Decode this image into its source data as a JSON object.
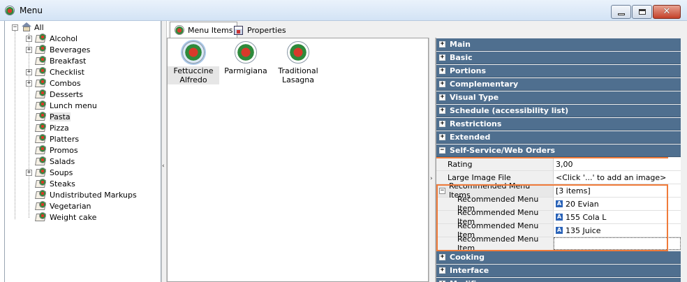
{
  "window": {
    "title": "Menu"
  },
  "tree": {
    "root": {
      "label": "All"
    },
    "items": [
      {
        "label": "Alcohol",
        "expandable": true
      },
      {
        "label": "Beverages",
        "expandable": true
      },
      {
        "label": "Breakfast",
        "expandable": false
      },
      {
        "label": "Checklist",
        "expandable": true
      },
      {
        "label": "Combos",
        "expandable": true
      },
      {
        "label": "Desserts",
        "expandable": false
      },
      {
        "label": "Lunch menu",
        "expandable": false
      },
      {
        "label": "Pasta",
        "expandable": false,
        "selected": true
      },
      {
        "label": "Pizza",
        "expandable": false
      },
      {
        "label": "Platters",
        "expandable": false
      },
      {
        "label": "Promos",
        "expandable": false
      },
      {
        "label": "Salads",
        "expandable": false
      },
      {
        "label": "Soups",
        "expandable": true
      },
      {
        "label": "Steaks",
        "expandable": false
      },
      {
        "label": "Undistributed Markups",
        "expandable": false
      },
      {
        "label": "Vegetarian",
        "expandable": false
      },
      {
        "label": "Weight cake",
        "expandable": false
      }
    ]
  },
  "tabs": [
    {
      "label": "Menu Items",
      "active": true
    },
    {
      "label": "Properties",
      "active": false
    }
  ],
  "menu_items": [
    {
      "label_line1": "Fettuccine",
      "label_line2": "Alfredo",
      "selected": true
    },
    {
      "label_line1": "Parmigiana",
      "label_line2": "",
      "selected": false
    },
    {
      "label_line1": "Traditional",
      "label_line2": "Lasagna",
      "selected": false
    }
  ],
  "property_grid": {
    "categories_top": [
      "Main",
      "Basic",
      "Portions",
      "Complementary",
      "Visual Type",
      "Schedule (accessibility list)",
      "Restrictions",
      "Extended"
    ],
    "expanded_category": "Self-Service/Web Orders",
    "properties": [
      {
        "name": "Rating",
        "value": "3,00"
      },
      {
        "name": "Large Image File",
        "value": "<Click '...' to add an image>"
      }
    ],
    "recommended_group": {
      "name": "Recommended Menu Items",
      "value": "[3 items]"
    },
    "recommended_items": [
      {
        "name": "Recommended Menu Item",
        "value": "20 Evian",
        "badge": "A"
      },
      {
        "name": "Recommended Menu Item",
        "value": "155 Cola L",
        "badge": "A"
      },
      {
        "name": "Recommended Menu Item",
        "value": "135 Juice",
        "badge": "A"
      },
      {
        "name": "Recommended Menu Item",
        "value": "",
        "badge": ""
      }
    ],
    "categories_bottom": [
      "Cooking",
      "Interface",
      "Modifiers"
    ]
  },
  "colors": {
    "category_bg": "#4f6f8f",
    "highlight": "#f07b3a"
  }
}
